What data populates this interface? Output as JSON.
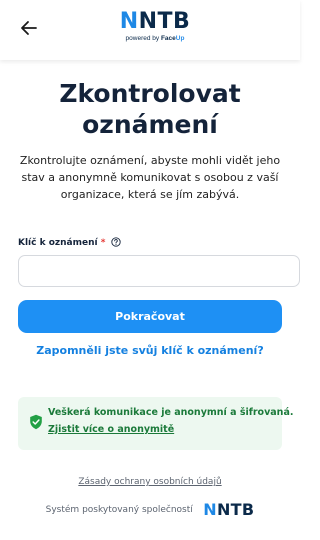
{
  "header": {
    "logo_first": "N",
    "logo_rest": "NTB",
    "powered_prefix": "powered by",
    "powered_brand": "Face",
    "powered_brand_suffix": "Up"
  },
  "title": "Zkontrolovat oznámení",
  "intro": "Zkontrolujte oznámení, abyste mohli vidět jeho stav a anonymně komunikovat s osobou z vaší organizace, která se jím zabývá.",
  "form": {
    "key_label": "Klíč k oznámení",
    "required_mark": "*",
    "key_value": "",
    "continue_label": "Pokračovat",
    "forgot_link": "Zapomněli jste svůj klíč k oznámení?"
  },
  "notice": {
    "text": "Veškerá komunikace je anonymní a šifrovaná.",
    "link": "Zjistit více o anonymitě"
  },
  "footer": {
    "privacy_link": "Zásady ochrany osobních údajů",
    "provided_by": "Systém poskytovaný společností",
    "logo_first": "N",
    "logo_rest": "NTB"
  },
  "icons": {
    "back": "arrow-left-icon",
    "help": "question-circle-icon",
    "shield": "shield-check-icon"
  },
  "colors": {
    "brand_blue": "#1e88e5",
    "brand_navy": "#0b2a4a",
    "button": "#1e90f4",
    "link": "#1480e0",
    "notice_bg": "#edf8f0",
    "notice_text": "#1b7a3a",
    "required": "#e53935"
  }
}
